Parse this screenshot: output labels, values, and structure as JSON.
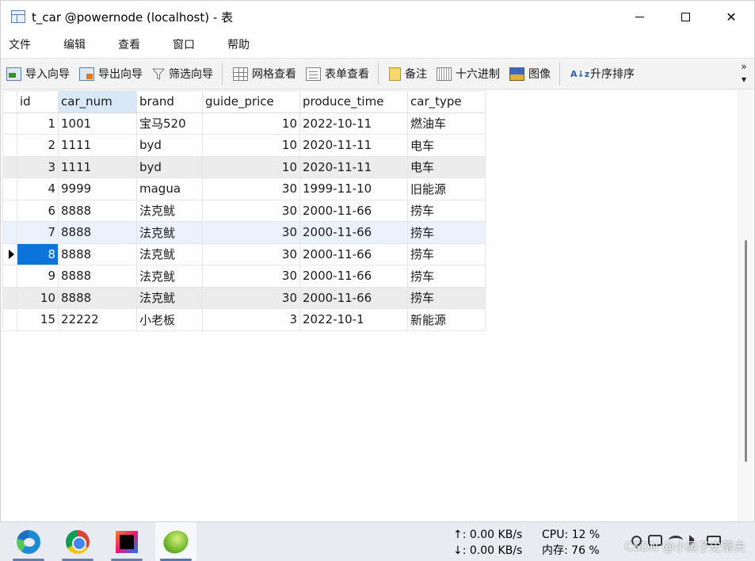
{
  "window": {
    "title": "t_car @powernode (localhost) - 表",
    "minimize": "—",
    "maximize": "☐",
    "close": "✕"
  },
  "menu": [
    "文件",
    "编辑",
    "查看",
    "窗口",
    "帮助"
  ],
  "toolbar": {
    "import": "导入向导",
    "export": "导出向导",
    "filter": "筛选向导",
    "grid_view": "网格查看",
    "form_view": "表单查看",
    "memo": "备注",
    "hex": "十六进制",
    "image": "图像",
    "sort_icon": "A↓z",
    "sort": "升序排序",
    "more": "»"
  },
  "grid": {
    "columns": [
      "id",
      "car_num",
      "brand",
      "guide_price",
      "produce_time",
      "car_type"
    ],
    "sorted_column": "car_num",
    "current_row_index": 6,
    "rows": [
      [
        "1",
        "1001",
        "宝马520",
        "10",
        "2022-10-11",
        "燃油车"
      ],
      [
        "2",
        "1111",
        "byd",
        "10",
        "2020-11-11",
        "电车"
      ],
      [
        "3",
        "1111",
        "byd",
        "10",
        "2020-11-11",
        "电车"
      ],
      [
        "4",
        "9999",
        "magua",
        "30",
        "1999-11-10",
        "旧能源"
      ],
      [
        "6",
        "8888",
        "法克鱿",
        "30",
        "2000-11-66",
        "捞车"
      ],
      [
        "7",
        "8888",
        "法克鱿",
        "30",
        "2000-11-66",
        "捞车"
      ],
      [
        "8",
        "8888",
        "法克鱿",
        "30",
        "2000-11-66",
        "捞车"
      ],
      [
        "9",
        "8888",
        "法克鱿",
        "30",
        "2000-11-66",
        "捞车"
      ],
      [
        "10",
        "8888",
        "法克鱿",
        "30",
        "2000-11-66",
        "捞车"
      ],
      [
        "15",
        "22222",
        "小老板",
        "3",
        "2022-10-1",
        "新能源"
      ]
    ]
  },
  "taskbar": {
    "apps": [
      "edge-icon",
      "chrome-icon",
      "intellij-icon",
      "navicat-icon"
    ],
    "net_up": "↑: 0.00 KB/s",
    "net_down": "↓: 0.00 KB/s",
    "cpu": "CPU: 12 %",
    "mem": "内存: 76 %",
    "watermark": "CSDN @小黑子史蒂夫"
  }
}
